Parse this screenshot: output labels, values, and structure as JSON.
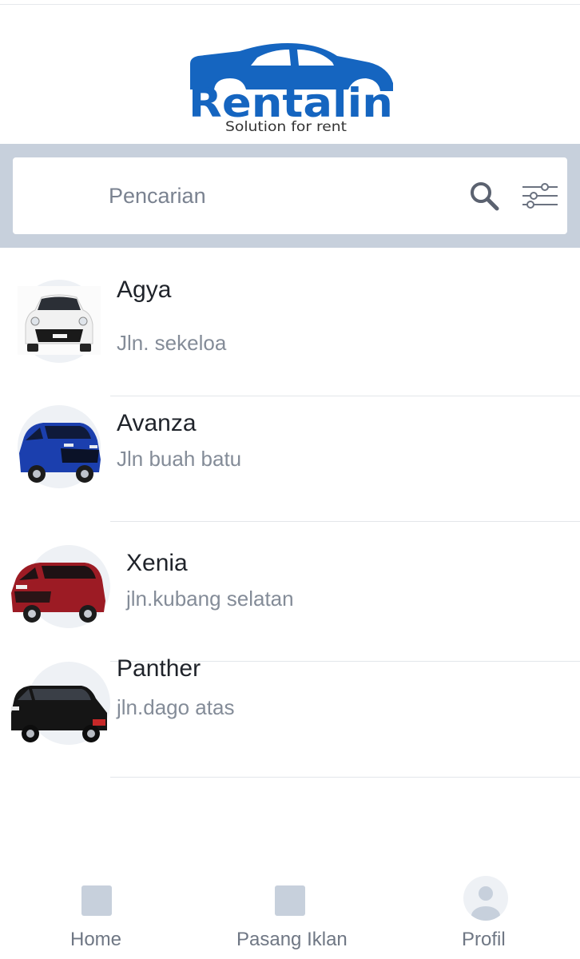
{
  "brand": {
    "name": "Rentalin",
    "tagline": "Solution for rent",
    "color": "#1565c0"
  },
  "search": {
    "placeholder": "Pencarian",
    "value": "",
    "search_icon": "search-icon",
    "filter_icon": "sliders-icon",
    "band_color": "#c7d0dc"
  },
  "cars": [
    {
      "name": "Agya",
      "address": "Jln. sekeloa",
      "color": "#f2f2f2"
    },
    {
      "name": "Avanza",
      "address": "Jln buah batu",
      "color": "#1b3fae"
    },
    {
      "name": "Xenia",
      "address": "jln.kubang selatan",
      "color": "#9c1b24"
    },
    {
      "name": "Panther",
      "address": "jln.dago atas",
      "color": "#151515"
    }
  ],
  "nav": {
    "items": [
      {
        "label": "Home",
        "icon": "home-icon"
      },
      {
        "label": "Pasang Iklan",
        "icon": "post-ad-icon"
      },
      {
        "label": "Profil",
        "icon": "user-icon"
      }
    ]
  }
}
